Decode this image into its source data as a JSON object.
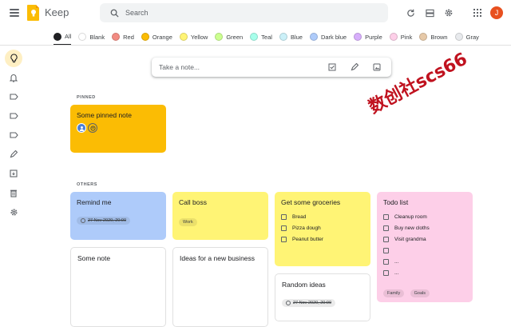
{
  "app": {
    "title": "Keep",
    "avatar_letter": "J",
    "accent": "#fbbc04"
  },
  "search": {
    "placeholder": "Search"
  },
  "filters": [
    {
      "label": "All",
      "color": "#202124"
    },
    {
      "label": "Blank",
      "color": "#ffffff"
    },
    {
      "label": "Red",
      "color": "#f28b82"
    },
    {
      "label": "Orange",
      "color": "#fbbc04"
    },
    {
      "label": "Yellow",
      "color": "#fff475"
    },
    {
      "label": "Green",
      "color": "#ccff90"
    },
    {
      "label": "Teal",
      "color": "#a7ffeb"
    },
    {
      "label": "Blue",
      "color": "#cbf0f8"
    },
    {
      "label": "Dark blue",
      "color": "#aecbfa"
    },
    {
      "label": "Purple",
      "color": "#d7aefb"
    },
    {
      "label": "Pink",
      "color": "#fdcfe8"
    },
    {
      "label": "Brown",
      "color": "#e6c9a8"
    },
    {
      "label": "Gray",
      "color": "#e8eaed"
    }
  ],
  "take_note": {
    "placeholder": "Take a note..."
  },
  "sections": {
    "pinned": "PINNED",
    "others": "OTHERS"
  },
  "pinned_note": {
    "title": "Some pinned note",
    "color": "#fbbc04"
  },
  "notes": {
    "remind": {
      "title": "Remind me",
      "date": "27 Nov 2020, 20:00",
      "color": "#aecbfa"
    },
    "callboss": {
      "title": "Call boss",
      "label": "Work",
      "color": "#fff475"
    },
    "groceries": {
      "title": "Get some groceries",
      "items": [
        "Bread",
        "Pizza dough",
        "Peanut butter"
      ],
      "color": "#fff475"
    },
    "todo": {
      "title": "Todo list",
      "items": [
        "Cleanup room",
        "Buy new cloths",
        "Visit grandma",
        "",
        "...",
        "..."
      ],
      "labels": [
        "Family",
        "Goals"
      ],
      "color": "#fdcfe8"
    },
    "somenote": {
      "title": "Some note"
    },
    "ideas": {
      "title": "Ideas for a new business"
    },
    "random": {
      "title": "Random ideas",
      "date": "27 Nov 2020, 20:00"
    }
  },
  "watermark": "数创社scs66"
}
